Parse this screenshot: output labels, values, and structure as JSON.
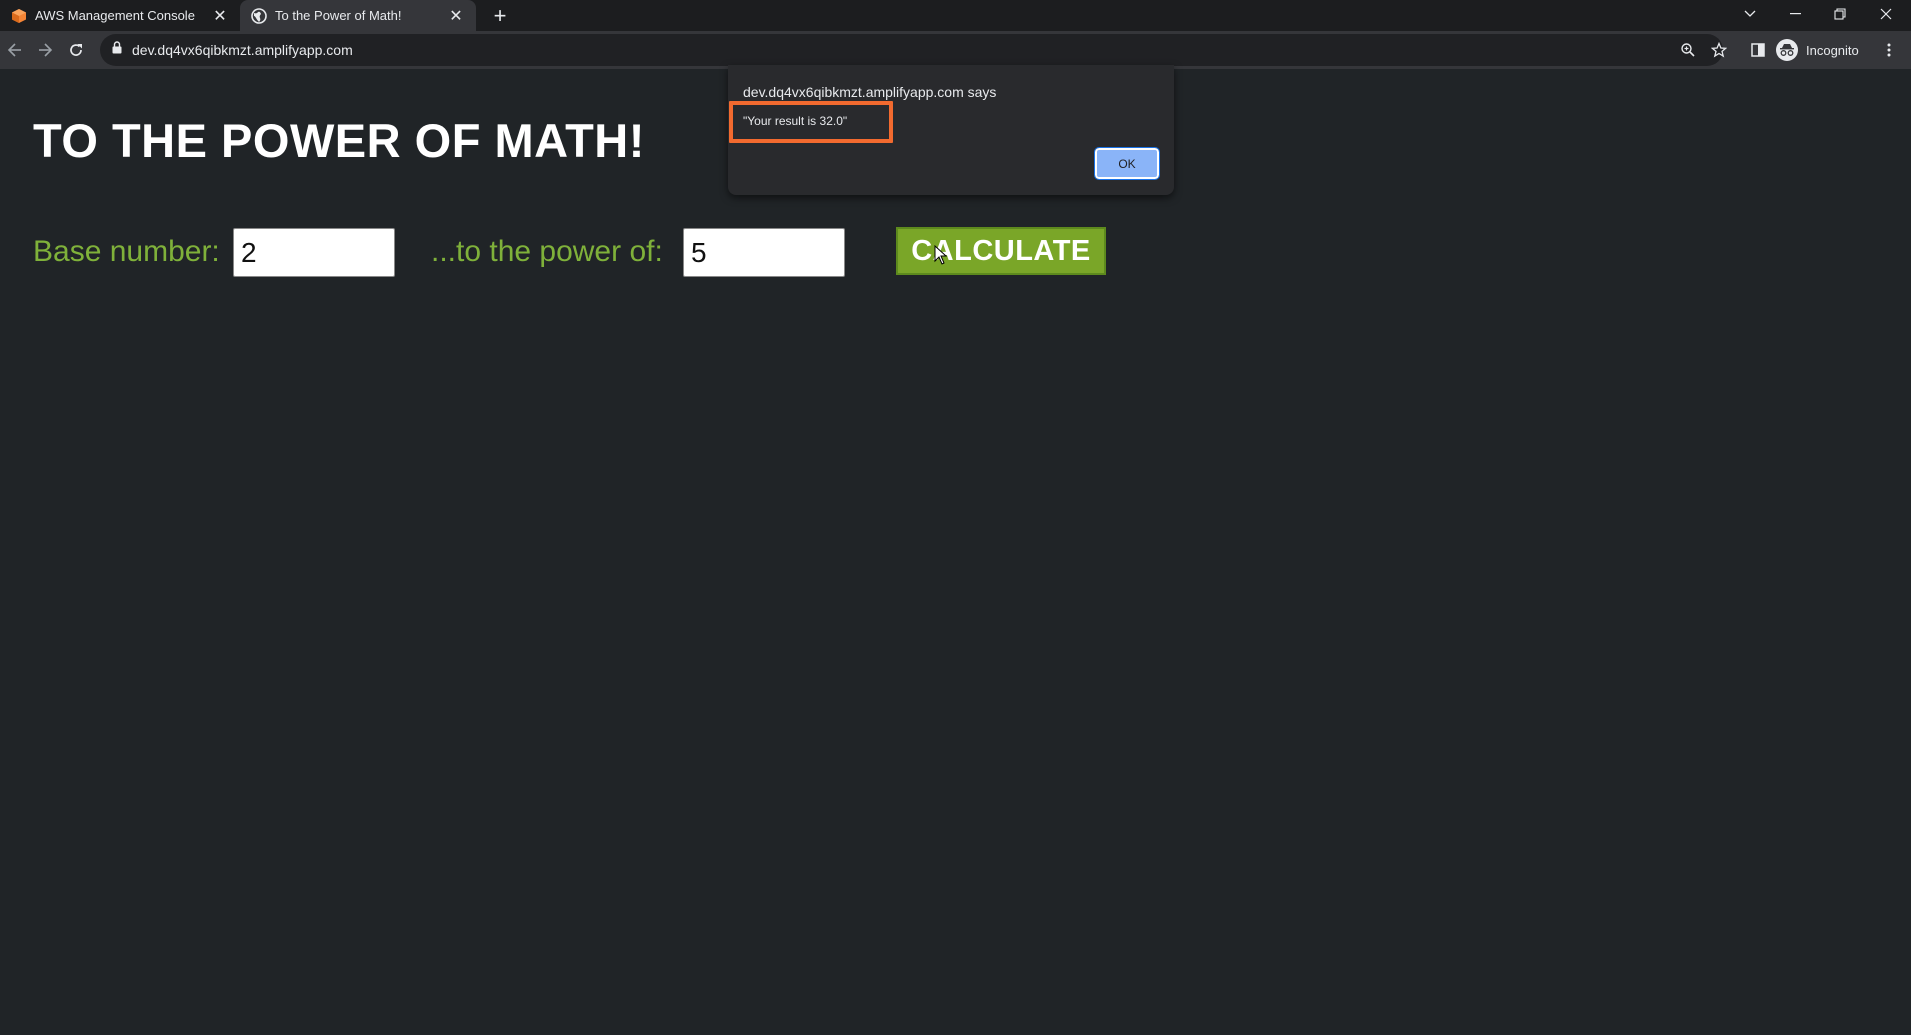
{
  "tabs": [
    {
      "title": "AWS Management Console",
      "icon": "aws-cube-icon",
      "active": false
    },
    {
      "title": "To the Power of Math!",
      "icon": "globe-icon",
      "active": true
    }
  ],
  "toolbar": {
    "url": "dev.dq4vx6qibkmzt.amplifyapp.com",
    "profile": "Incognito"
  },
  "page": {
    "heading": "TO THE POWER OF MATH!",
    "base_label": "Base number:",
    "base_value": "2",
    "power_label": "...to the power of:",
    "power_value": "5",
    "calculate_label": "CALCULATE"
  },
  "dialog": {
    "origin": "dev.dq4vx6qibkmzt.amplifyapp.com says",
    "message": "\"Your result is 32.0\"",
    "ok_label": "OK"
  },
  "colors": {
    "background": "#202427",
    "label_green": "#7fb13a",
    "button_green": "#7aa628",
    "highlight": "#f26a2f",
    "ok_blue": "#8ab4f8"
  }
}
